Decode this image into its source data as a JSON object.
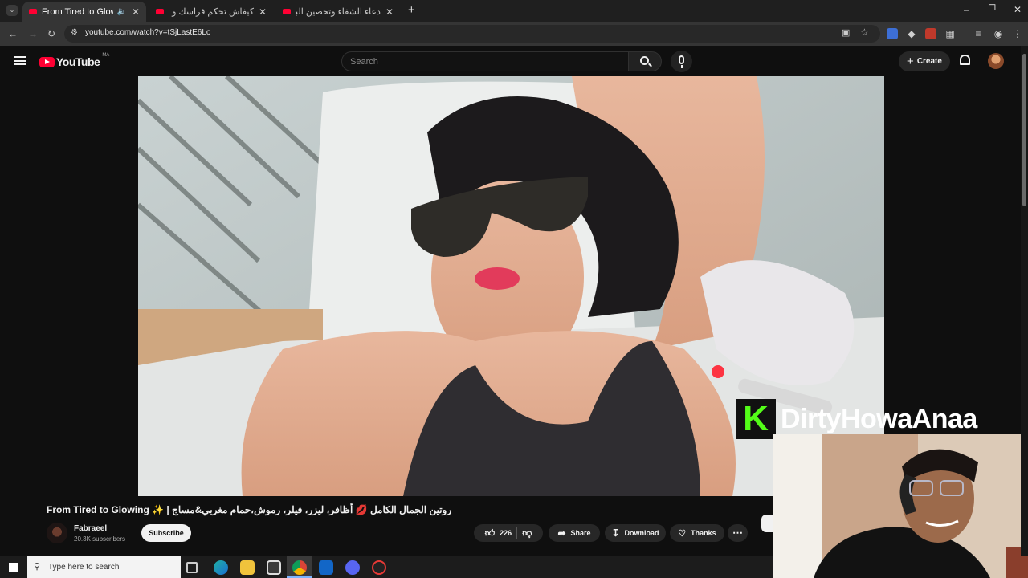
{
  "browser": {
    "tabs": [
      {
        "title": "From Tired to Glowing ✨",
        "active": true
      },
      {
        "title": "كيفاش تحكم فراسك و تقاوم الشَ",
        "active": false
      },
      {
        "title": "دعاء الشفاء وتحصين البيت من ال",
        "active": false
      }
    ],
    "new_tab_label": "+",
    "url": "youtube.com/watch?v=tSjLastE6Lo"
  },
  "youtube": {
    "logo_text": "YouTube",
    "region": "MA",
    "search_placeholder": "Search",
    "create_label": "Create"
  },
  "video": {
    "title": "From Tired to Glowing ✨ | روتين الجمال الكامل 💋 أظافر، ليزر، فيلر، رموش،حمام مغربي&مساج",
    "channel": "Fabraeel",
    "subscribers": "20.3K subscribers",
    "subscribe_label": "Subscribe",
    "likes": "226",
    "share_label": "Share",
    "download_label": "Download",
    "thanks_label": "Thanks"
  },
  "overlay": {
    "streamer_name": "DirtyHowaAnaa",
    "logo_letter": "K",
    "brand_color": "#53fc18"
  },
  "taskbar": {
    "search_placeholder": "Type here to search"
  },
  "colors": {
    "youtube_red": "#ff0033",
    "bg": "#0f0f0f"
  }
}
